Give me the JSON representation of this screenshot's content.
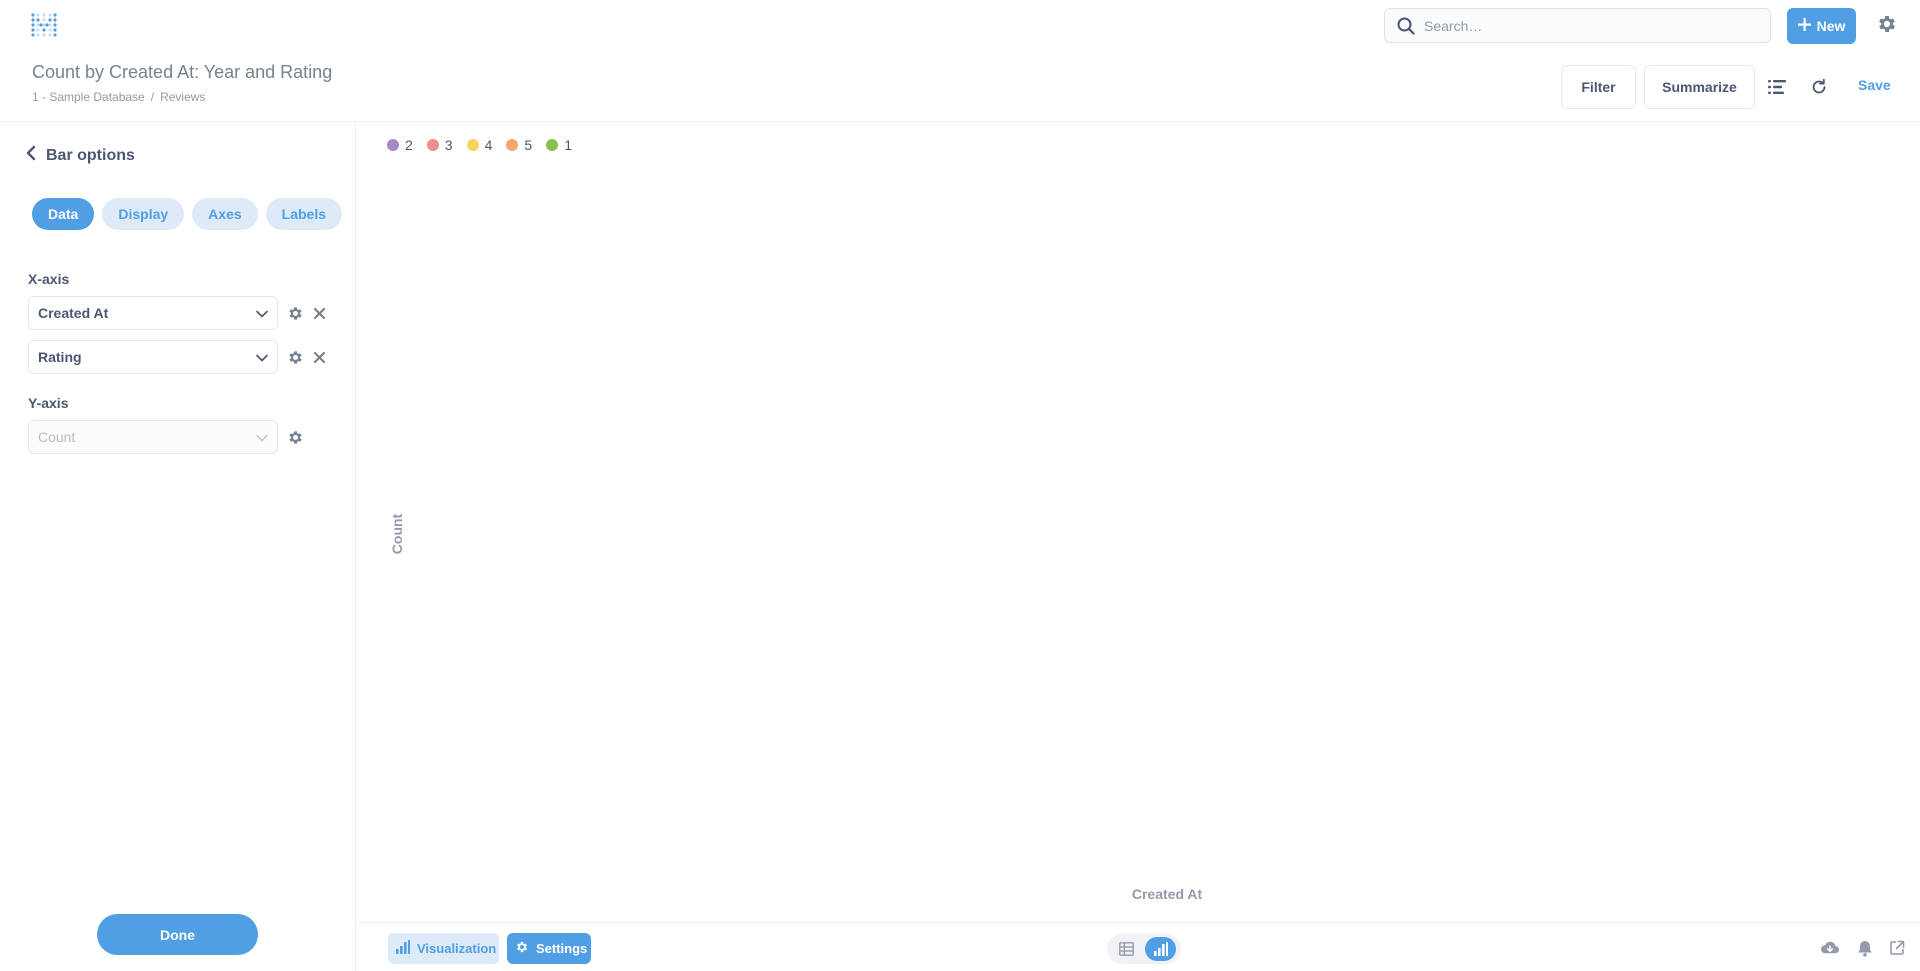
{
  "search": {
    "placeholder": "Search…"
  },
  "nav": {
    "new_label": "New"
  },
  "question": {
    "title": "Count by Created At: Year and Rating",
    "breadcrumb": [
      "1 - Sample Database",
      "/",
      "Reviews"
    ]
  },
  "header": {
    "filter_label": "Filter",
    "summarize_label": "Summarize",
    "save_label": "Save"
  },
  "sidebar": {
    "title": "Bar options",
    "tabs": [
      "Data",
      "Display",
      "Axes",
      "Labels"
    ],
    "active_tab": "Data",
    "x_axis_label": "X-axis",
    "x_fields": [
      "Created At",
      "Rating"
    ],
    "y_axis_label": "Y-axis",
    "y_field": "Count",
    "done_label": "Done"
  },
  "chart_data": {
    "type": "bar",
    "legend": [
      {
        "name": "2",
        "color": "#a989c5"
      },
      {
        "name": "3",
        "color": "#ef8c8c"
      },
      {
        "name": "4",
        "color": "#f9d45c"
      },
      {
        "name": "5",
        "color": "#f2a86f"
      },
      {
        "name": "1",
        "color": "#88bf4d"
      }
    ],
    "xlabel": "Created At",
    "ylabel": "Count",
    "legend_position": "top-left"
  },
  "footer": {
    "visualization_label": "Visualization",
    "settings_label": "Settings"
  },
  "colors": {
    "brand": "#509ee3",
    "text": "#4c5773",
    "muted": "#949aab"
  }
}
